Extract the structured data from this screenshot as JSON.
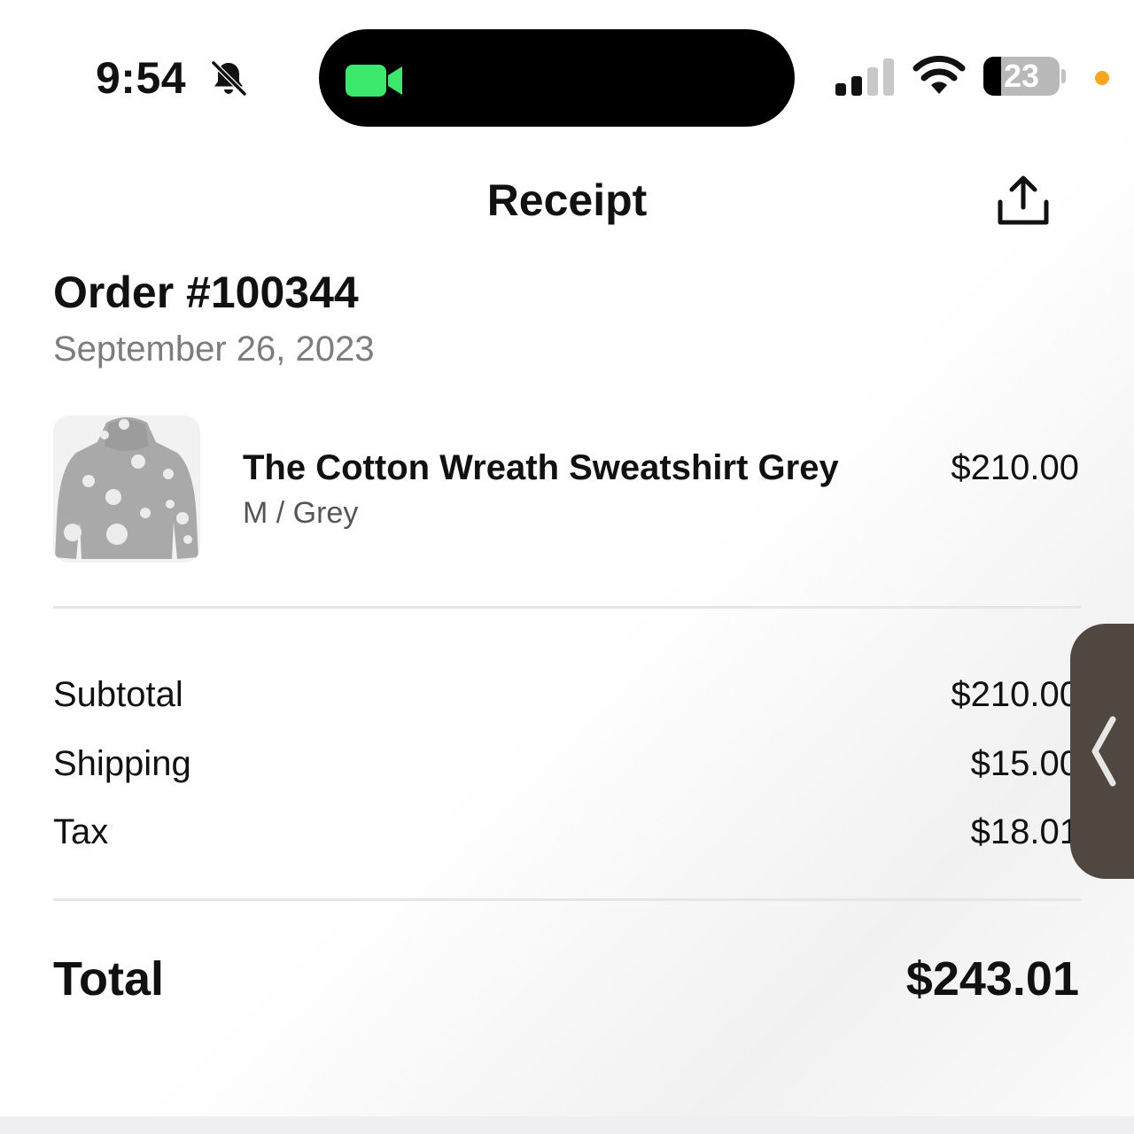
{
  "status_bar": {
    "time": "9:54",
    "battery_level": "23",
    "battery_fraction": 0.23,
    "icons": [
      "bell-slash-icon",
      "facetime-camera-icon",
      "cellular-signal-icon",
      "wifi-icon",
      "battery-icon",
      "privacy-indicator-dot"
    ],
    "camera_color": "#3ce86b",
    "privacy_dot_color": "#f5a623"
  },
  "header": {
    "title": "Receipt",
    "share_icon": "share-icon"
  },
  "order": {
    "number": "Order #100344",
    "date": "September 26, 2023"
  },
  "items": [
    {
      "name": "The Cotton Wreath Sweatshirt Grey",
      "variant": "M / Grey",
      "price": "$210.00",
      "thumbnail_icon": "hoodie-thumbnail"
    }
  ],
  "summary": {
    "rows": [
      {
        "label": "Subtotal",
        "value": "$210.00"
      },
      {
        "label": "Shipping",
        "value": "$15.00"
      },
      {
        "label": "Tax",
        "value": "$18.01"
      }
    ],
    "total_label": "Total",
    "total_value": "$243.01"
  },
  "side_tab": {
    "icon": "chevron-left-icon",
    "color": "#4f4740"
  }
}
